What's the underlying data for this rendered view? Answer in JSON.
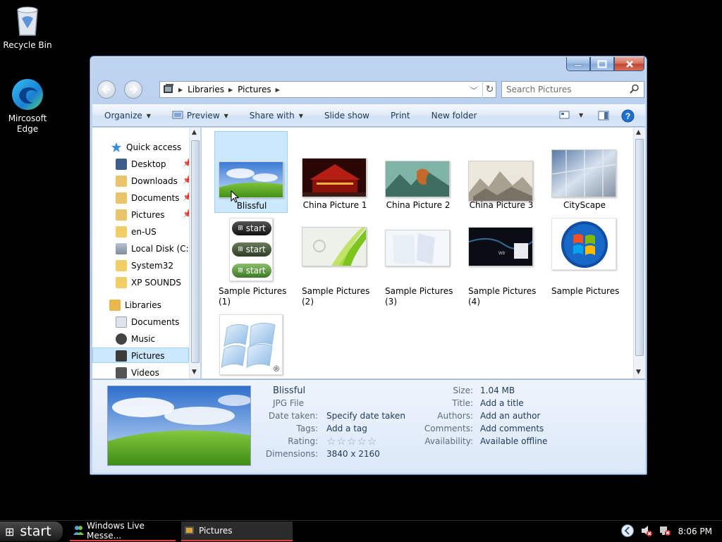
{
  "desktop": {
    "icons": [
      {
        "label": "Recycle Bin",
        "icon": "recycle-bin-icon"
      },
      {
        "label": "Mircosoft Edge",
        "icon": "edge-icon"
      }
    ]
  },
  "window": {
    "address": {
      "crumbs": [
        "Libraries",
        "Pictures"
      ]
    },
    "search": {
      "placeholder": "Search Pictures"
    },
    "toolbar": {
      "organize": "Organize",
      "preview": "Preview",
      "share_with": "Share with",
      "slide_show": "Slide show",
      "print": "Print",
      "new_folder": "New folder"
    },
    "nav": {
      "quick_access": "Quick access",
      "desktop": "Desktop",
      "downloads": "Downloads",
      "documents": "Documents",
      "pictures": "Pictures",
      "en_us": "en-US",
      "local_disk": "Local Disk (C:)",
      "system32": "System32",
      "xp_sounds": "XP SOUNDS",
      "libraries": "Libraries",
      "lib_documents": "Documents",
      "lib_music": "Music",
      "lib_pictures": "Pictures",
      "lib_videos": "Videos"
    },
    "files": [
      {
        "name": "Blissful",
        "selected": true
      },
      {
        "name": "China Picture 1"
      },
      {
        "name": "China Picture 2"
      },
      {
        "name": "China Picture 3"
      },
      {
        "name": "CityScape"
      },
      {
        "name": "Sample Pictures (1)"
      },
      {
        "name": "Sample Pictures (2)"
      },
      {
        "name": "Sample Pictures (3)"
      },
      {
        "name": "Sample Pictures (4)"
      },
      {
        "name": "Sample Pictures"
      },
      {
        "name": ""
      }
    ],
    "start_orbs": [
      "start",
      "start",
      "start"
    ],
    "details": {
      "name": "Blissful",
      "type": "JPG File",
      "date_taken_label": "Date taken:",
      "date_taken": "Specify date taken",
      "tags_label": "Tags:",
      "tags": "Add a tag",
      "rating_label": "Rating:",
      "rating": 0,
      "rating_stars": "☆☆☆☆☆",
      "dimensions_label": "Dimensions:",
      "dimensions": "3840 x 2160",
      "size_label": "Size:",
      "size": "1.04 MB",
      "title_label": "Title:",
      "title": "Add a title",
      "authors_label": "Authors:",
      "authors": "Add an author",
      "comments_label": "Comments:",
      "comments": "Add comments",
      "availability_label": "Availability:",
      "availability": "Available offline"
    }
  },
  "taskbar": {
    "start": "start",
    "tasks": [
      "Windows Live Messe...",
      "Pictures"
    ],
    "clock": "8:06 PM"
  },
  "colors": {
    "accent": "#1e395b",
    "selection": "#cce8ff",
    "window_frame": "#a9c5eb"
  }
}
